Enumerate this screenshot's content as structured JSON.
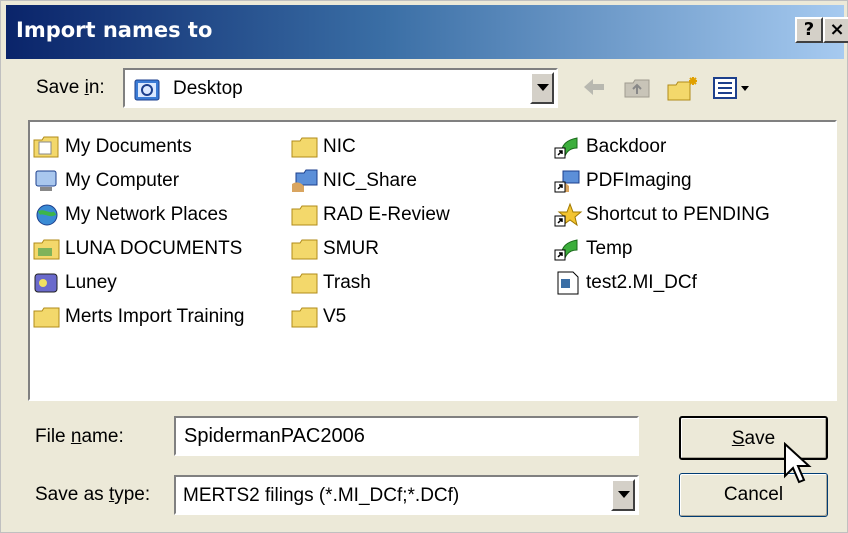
{
  "window": {
    "title": "Import names to",
    "help_label": "?",
    "close_label": "×"
  },
  "save_in": {
    "label_pre": "Save ",
    "label_accel": "i",
    "label_post": "n:",
    "value": "Desktop"
  },
  "toolbar": {
    "icons": [
      "back-arrow-icon",
      "up-folder-icon",
      "new-folder-icon",
      "view-menu-icon"
    ]
  },
  "files": {
    "col1": [
      {
        "name": "My Documents",
        "icon": "my-documents-icon"
      },
      {
        "name": "My Computer",
        "icon": "my-computer-icon"
      },
      {
        "name": "My Network Places",
        "icon": "network-places-icon"
      },
      {
        "name": "LUNA DOCUMENTS",
        "icon": "folder-icon"
      },
      {
        "name": "Luney",
        "icon": "drive-icon"
      },
      {
        "name": "Merts Import Training",
        "icon": "folder-icon"
      }
    ],
    "col2": [
      {
        "name": "NIC",
        "icon": "folder-icon"
      },
      {
        "name": "NIC_Share",
        "icon": "shared-folder-icon"
      },
      {
        "name": "RAD E-Review",
        "icon": "folder-icon"
      },
      {
        "name": "SMUR",
        "icon": "folder-icon"
      },
      {
        "name": "Trash",
        "icon": "folder-icon"
      },
      {
        "name": "V5",
        "icon": "folder-icon"
      }
    ],
    "col3": [
      {
        "name": "Backdoor",
        "icon": "shortcut-icon"
      },
      {
        "name": "PDFImaging",
        "icon": "network-shortcut-icon"
      },
      {
        "name": "Shortcut to PENDING",
        "icon": "star-shortcut-icon"
      },
      {
        "name": "Temp",
        "icon": "shortcut-icon"
      },
      {
        "name": "test2.MI_DCf",
        "icon": "document-icon"
      }
    ]
  },
  "file_name": {
    "label_pre": "File ",
    "label_accel": "n",
    "label_post": "ame:",
    "value": "SpidermanPAC2006"
  },
  "save_as_type": {
    "label_pre": "Save as ",
    "label_accel": "t",
    "label_post": "ype:",
    "value": "MERTS2 filings (*.MI_DCf;*.DCf)"
  },
  "buttons": {
    "save_accel": "S",
    "save_rest": "ave",
    "cancel": "Cancel"
  }
}
